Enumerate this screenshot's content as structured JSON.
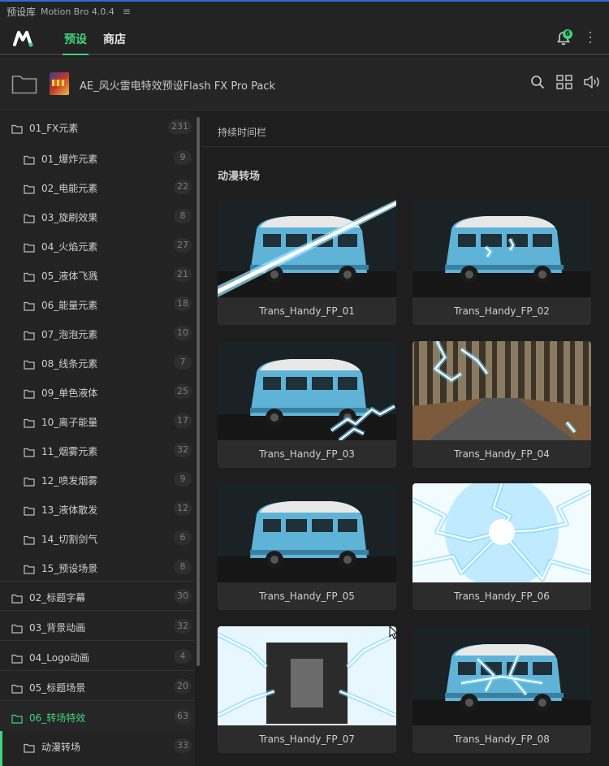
{
  "window": {
    "title": "预设库",
    "app_version": "Motion Bro 4.0.4",
    "menu_glyph": "≡"
  },
  "nav": {
    "tabs": [
      {
        "label": "预设",
        "active": true
      },
      {
        "label": "商店",
        "active": false
      }
    ],
    "notification_count": "6",
    "accent_color": "#3fd47e"
  },
  "pack": {
    "title": "AE_风火雷电特效预设Flash FX Pro Pack",
    "icons": [
      "search-icon",
      "grid-view-icon",
      "speaker-icon"
    ]
  },
  "sidebar": {
    "items": [
      {
        "label": "01_FX元素",
        "count": "231",
        "level": 0
      },
      {
        "label": "01_爆炸元素",
        "count": "9",
        "level": 1
      },
      {
        "label": "02_电能元素",
        "count": "22",
        "level": 1
      },
      {
        "label": "03_旋刷效果",
        "count": "8",
        "level": 1
      },
      {
        "label": "04_火焰元素",
        "count": "27",
        "level": 1
      },
      {
        "label": "05_液体飞溅",
        "count": "21",
        "level": 1
      },
      {
        "label": "06_能量元素",
        "count": "18",
        "level": 1
      },
      {
        "label": "07_泡泡元素",
        "count": "10",
        "level": 1
      },
      {
        "label": "08_线条元素",
        "count": "7",
        "level": 1
      },
      {
        "label": "09_单色液体",
        "count": "25",
        "level": 1
      },
      {
        "label": "10_离子能量",
        "count": "17",
        "level": 1
      },
      {
        "label": "11_烟雾元素",
        "count": "32",
        "level": 1
      },
      {
        "label": "12_喷发烟雾",
        "count": "9",
        "level": 1
      },
      {
        "label": "13_液体散发",
        "count": "12",
        "level": 1
      },
      {
        "label": "14_切割剑气",
        "count": "6",
        "level": 1
      },
      {
        "label": "15_预设场景",
        "count": "8",
        "level": 1
      },
      {
        "label": "02_标题字幕",
        "count": "30",
        "level": 0
      },
      {
        "label": "03_背景动画",
        "count": "32",
        "level": 0
      },
      {
        "label": "04_Logo动画",
        "count": "4",
        "level": 0
      },
      {
        "label": "05_标题场景",
        "count": "20",
        "level": 0
      },
      {
        "label": "06_转场特效",
        "count": "63",
        "level": 0,
        "active": true
      },
      {
        "label": "动漫转场",
        "count": "33",
        "level": 1
      }
    ]
  },
  "main": {
    "duration_label": "持续时间栏",
    "category_title": "动漫转场",
    "presets": [
      {
        "name": "Trans_Handy_FP_01"
      },
      {
        "name": "Trans_Handy_FP_02"
      },
      {
        "name": "Trans_Handy_FP_03"
      },
      {
        "name": "Trans_Handy_FP_04"
      },
      {
        "name": "Trans_Handy_FP_05"
      },
      {
        "name": "Trans_Handy_FP_06"
      },
      {
        "name": "Trans_Handy_FP_07"
      },
      {
        "name": "Trans_Handy_FP_08"
      }
    ]
  }
}
